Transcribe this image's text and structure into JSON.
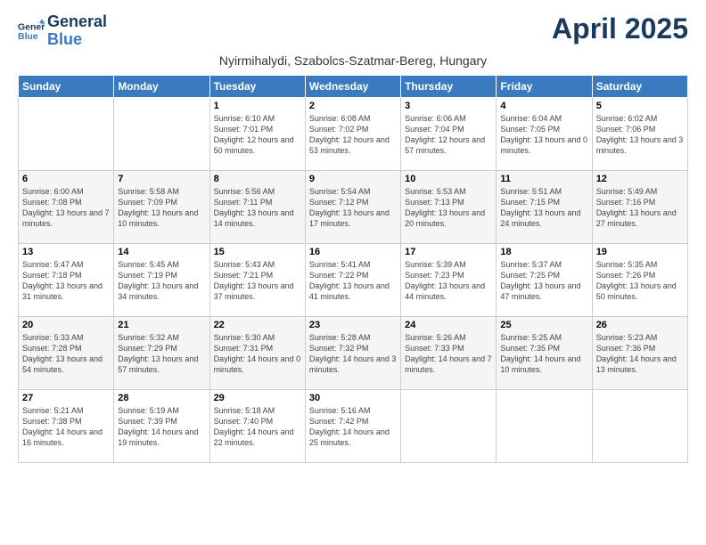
{
  "logo": {
    "line1": "General",
    "line2": "Blue"
  },
  "title": "April 2025",
  "subtitle": "Nyirmihalydi, Szabolcs-Szatmar-Bereg, Hungary",
  "header_days": [
    "Sunday",
    "Monday",
    "Tuesday",
    "Wednesday",
    "Thursday",
    "Friday",
    "Saturday"
  ],
  "weeks": [
    [
      {
        "day": "",
        "info": ""
      },
      {
        "day": "",
        "info": ""
      },
      {
        "day": "1",
        "info": "Sunrise: 6:10 AM\nSunset: 7:01 PM\nDaylight: 12 hours\nand 50 minutes."
      },
      {
        "day": "2",
        "info": "Sunrise: 6:08 AM\nSunset: 7:02 PM\nDaylight: 12 hours\nand 53 minutes."
      },
      {
        "day": "3",
        "info": "Sunrise: 6:06 AM\nSunset: 7:04 PM\nDaylight: 12 hours\nand 57 minutes."
      },
      {
        "day": "4",
        "info": "Sunrise: 6:04 AM\nSunset: 7:05 PM\nDaylight: 13 hours\nand 0 minutes."
      },
      {
        "day": "5",
        "info": "Sunrise: 6:02 AM\nSunset: 7:06 PM\nDaylight: 13 hours\nand 3 minutes."
      }
    ],
    [
      {
        "day": "6",
        "info": "Sunrise: 6:00 AM\nSunset: 7:08 PM\nDaylight: 13 hours\nand 7 minutes."
      },
      {
        "day": "7",
        "info": "Sunrise: 5:58 AM\nSunset: 7:09 PM\nDaylight: 13 hours\nand 10 minutes."
      },
      {
        "day": "8",
        "info": "Sunrise: 5:56 AM\nSunset: 7:11 PM\nDaylight: 13 hours\nand 14 minutes."
      },
      {
        "day": "9",
        "info": "Sunrise: 5:54 AM\nSunset: 7:12 PM\nDaylight: 13 hours\nand 17 minutes."
      },
      {
        "day": "10",
        "info": "Sunrise: 5:53 AM\nSunset: 7:13 PM\nDaylight: 13 hours\nand 20 minutes."
      },
      {
        "day": "11",
        "info": "Sunrise: 5:51 AM\nSunset: 7:15 PM\nDaylight: 13 hours\nand 24 minutes."
      },
      {
        "day": "12",
        "info": "Sunrise: 5:49 AM\nSunset: 7:16 PM\nDaylight: 13 hours\nand 27 minutes."
      }
    ],
    [
      {
        "day": "13",
        "info": "Sunrise: 5:47 AM\nSunset: 7:18 PM\nDaylight: 13 hours\nand 31 minutes."
      },
      {
        "day": "14",
        "info": "Sunrise: 5:45 AM\nSunset: 7:19 PM\nDaylight: 13 hours\nand 34 minutes."
      },
      {
        "day": "15",
        "info": "Sunrise: 5:43 AM\nSunset: 7:21 PM\nDaylight: 13 hours\nand 37 minutes."
      },
      {
        "day": "16",
        "info": "Sunrise: 5:41 AM\nSunset: 7:22 PM\nDaylight: 13 hours\nand 41 minutes."
      },
      {
        "day": "17",
        "info": "Sunrise: 5:39 AM\nSunset: 7:23 PM\nDaylight: 13 hours\nand 44 minutes."
      },
      {
        "day": "18",
        "info": "Sunrise: 5:37 AM\nSunset: 7:25 PM\nDaylight: 13 hours\nand 47 minutes."
      },
      {
        "day": "19",
        "info": "Sunrise: 5:35 AM\nSunset: 7:26 PM\nDaylight: 13 hours\nand 50 minutes."
      }
    ],
    [
      {
        "day": "20",
        "info": "Sunrise: 5:33 AM\nSunset: 7:28 PM\nDaylight: 13 hours\nand 54 minutes."
      },
      {
        "day": "21",
        "info": "Sunrise: 5:32 AM\nSunset: 7:29 PM\nDaylight: 13 hours\nand 57 minutes."
      },
      {
        "day": "22",
        "info": "Sunrise: 5:30 AM\nSunset: 7:31 PM\nDaylight: 14 hours\nand 0 minutes."
      },
      {
        "day": "23",
        "info": "Sunrise: 5:28 AM\nSunset: 7:32 PM\nDaylight: 14 hours\nand 3 minutes."
      },
      {
        "day": "24",
        "info": "Sunrise: 5:26 AM\nSunset: 7:33 PM\nDaylight: 14 hours\nand 7 minutes."
      },
      {
        "day": "25",
        "info": "Sunrise: 5:25 AM\nSunset: 7:35 PM\nDaylight: 14 hours\nand 10 minutes."
      },
      {
        "day": "26",
        "info": "Sunrise: 5:23 AM\nSunset: 7:36 PM\nDaylight: 14 hours\nand 13 minutes."
      }
    ],
    [
      {
        "day": "27",
        "info": "Sunrise: 5:21 AM\nSunset: 7:38 PM\nDaylight: 14 hours\nand 16 minutes."
      },
      {
        "day": "28",
        "info": "Sunrise: 5:19 AM\nSunset: 7:39 PM\nDaylight: 14 hours\nand 19 minutes."
      },
      {
        "day": "29",
        "info": "Sunrise: 5:18 AM\nSunset: 7:40 PM\nDaylight: 14 hours\nand 22 minutes."
      },
      {
        "day": "30",
        "info": "Sunrise: 5:16 AM\nSunset: 7:42 PM\nDaylight: 14 hours\nand 25 minutes."
      },
      {
        "day": "",
        "info": ""
      },
      {
        "day": "",
        "info": ""
      },
      {
        "day": "",
        "info": ""
      }
    ]
  ]
}
